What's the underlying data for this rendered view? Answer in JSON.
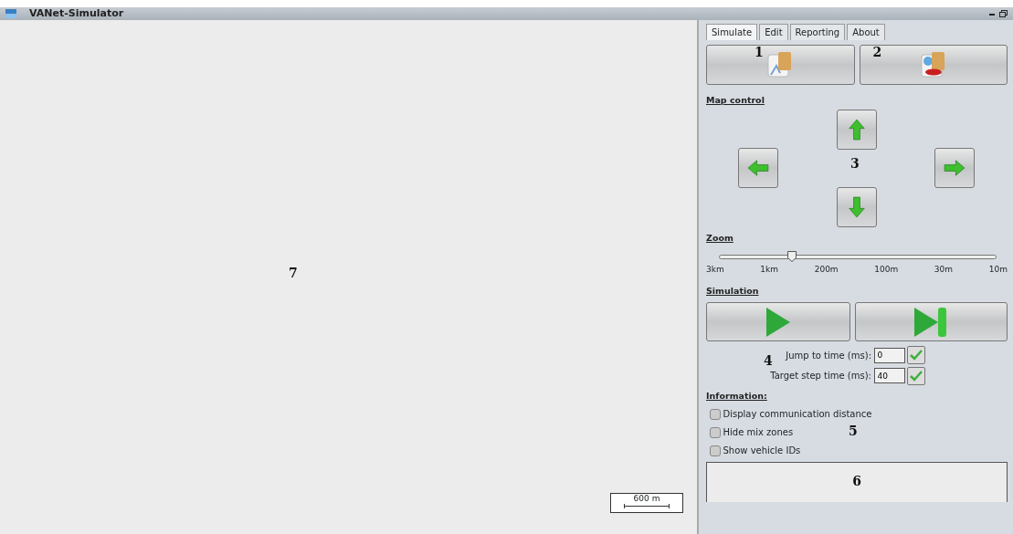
{
  "window": {
    "title": "VANet-Simulator"
  },
  "map": {
    "callout": "7",
    "scale_label": "600 m"
  },
  "tabs": [
    {
      "label": "Simulate",
      "selected": true
    },
    {
      "label": "Edit",
      "selected": false
    },
    {
      "label": "Reporting",
      "selected": false
    },
    {
      "label": "About",
      "selected": false
    }
  ],
  "file_buttons": {
    "callouts": [
      "1",
      "2"
    ]
  },
  "map_control": {
    "heading": "Map control",
    "callout": "3"
  },
  "zoom": {
    "heading": "Zoom",
    "level": 0.26,
    "labels": [
      "3km",
      "1km",
      "200m",
      "100m",
      "30m",
      "10m"
    ]
  },
  "simulation": {
    "heading": "Simulation",
    "callout": "4",
    "fields": [
      {
        "label": "Jump to time (ms):",
        "value": "0"
      },
      {
        "label": "Target step time (ms):",
        "value": "40"
      }
    ]
  },
  "information": {
    "heading": "Information:",
    "callout": "5",
    "options": [
      {
        "label": "Display communication distance",
        "checked": false
      },
      {
        "label": "Hide mix zones",
        "checked": false
      },
      {
        "label": "Show vehicle IDs",
        "checked": false
      }
    ]
  },
  "status_box": {
    "callout": "6"
  }
}
